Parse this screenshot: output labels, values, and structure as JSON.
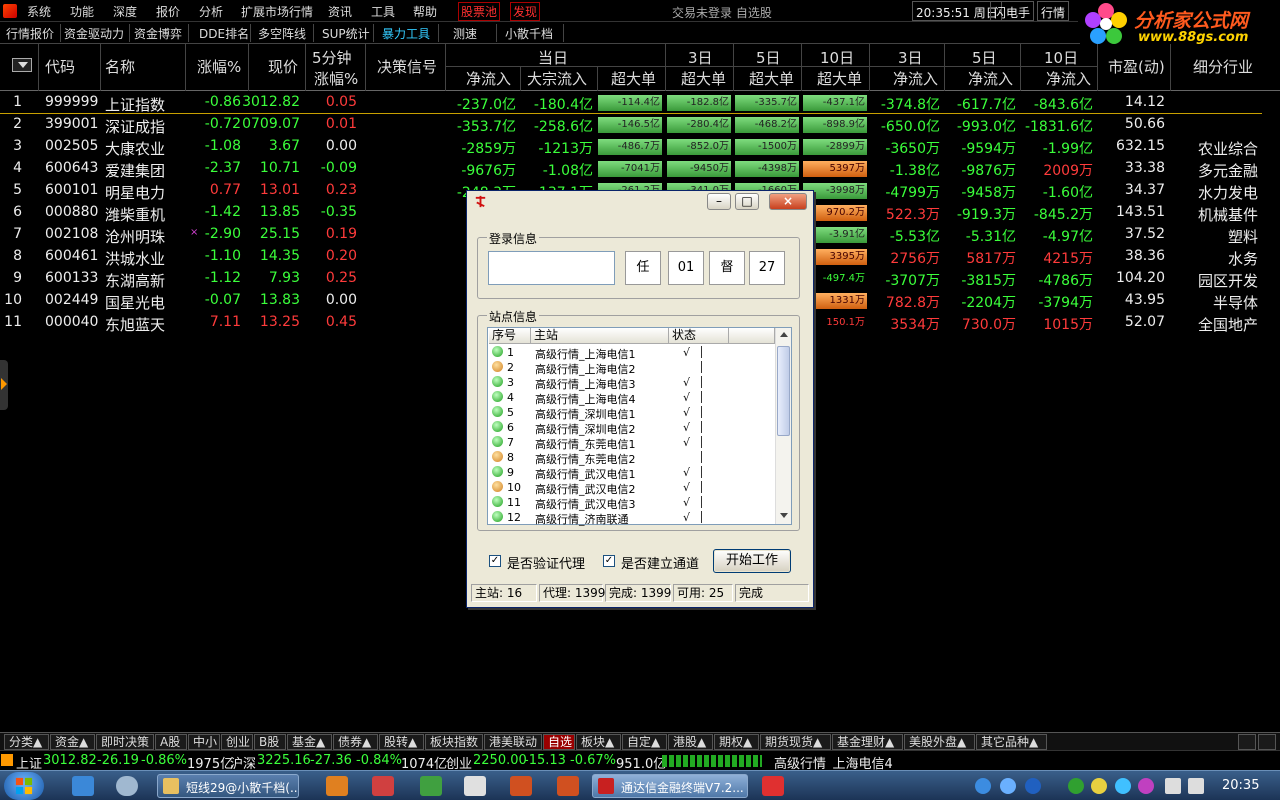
{
  "menu": {
    "items": [
      "系统",
      "功能",
      "深度",
      "报价",
      "分析",
      "扩展市场行情",
      "资讯",
      "工具",
      "帮助"
    ],
    "hot": [
      "股票池",
      "发现"
    ],
    "center_text": "交易未登录   自选股",
    "clock": "20:35:51 周日",
    "flash": "闪电手",
    "quote": "行情"
  },
  "brand": {
    "name": "分析家公式网",
    "url": "www.88gs.com"
  },
  "tabs": [
    "行情报价",
    "资金驱动力",
    "资金博弈",
    "DDE排名",
    "多空阵线",
    "SUP统计",
    "暴力工具",
    "测速",
    "小散千档"
  ],
  "active_tab": "暴力工具",
  "header": {
    "code": "代码",
    "name": "名称",
    "change": "涨幅%",
    "price": "现价",
    "speed_top": "5分钟",
    "speed_bottom": "涨幅%",
    "signal": "决策信号",
    "today": "当日",
    "d3": "3日",
    "d5": "5日",
    "d10": "10日",
    "net_in": "净流入",
    "block_in": "大宗流入",
    "super": "超大单",
    "pe": "市盈(动)",
    "industry": "细分行业"
  },
  "rows": [
    {
      "no": "1",
      "code": "999999",
      "name": "上证指数",
      "chg": "-0.86",
      "price": "3012.82",
      "spd": "0.05",
      "net": "-237.0亿",
      "blk": "-180.4亿",
      "s1": "-114.4亿",
      "s3": "-182.8亿",
      "s5": "-335.7亿",
      "s10": "-437.1亿",
      "n3": "-374.8亿",
      "n5": "-617.7亿",
      "n10": "-843.6亿",
      "pe": "14.12",
      "ind": "",
      "mark": ""
    },
    {
      "no": "2",
      "code": "399001",
      "name": "深证成指",
      "chg": "-0.72",
      "price": "0709.07",
      "spd": "0.01",
      "net": "-353.7亿",
      "blk": "-258.6亿",
      "s1": "-146.5亿",
      "s3": "-280.4亿",
      "s5": "-468.2亿",
      "s10": "-898.9亿",
      "n3": "-650.0亿",
      "n5": "-993.0亿",
      "n10": "-1831.6亿",
      "pe": "50.66",
      "ind": "",
      "mark": ""
    },
    {
      "no": "3",
      "code": "002505",
      "name": "大康农业",
      "chg": "-1.08",
      "price": "3.67",
      "spd": "0.00",
      "net": "-2859万",
      "blk": "-1213万",
      "s1": "-486.7万",
      "s3": "-852.0万",
      "s5": "-1500万",
      "s10": "-2899万",
      "n3": "-3650万",
      "n5": "-9594万",
      "n10": "-1.99亿",
      "pe": "632.15",
      "ind": "农业综合",
      "mark": ""
    },
    {
      "no": "4",
      "code": "600643",
      "name": "爱建集团",
      "chg": "-2.37",
      "price": "10.71",
      "spd": "-0.09",
      "net": "-9676万",
      "blk": "-1.08亿",
      "s1": "-7041万",
      "s3": "-9450万",
      "s5": "-4398万",
      "s10": "5397万",
      "n3": "-1.38亿",
      "n5": "-9876万",
      "n10": "2009万",
      "pe": "33.38",
      "ind": "多元金融",
      "mark": ""
    },
    {
      "no": "5",
      "code": "600101",
      "name": "明星电力",
      "chg": "0.77",
      "price": "13.01",
      "spd": "0.23",
      "net": "-248.3万",
      "blk": "-137.1万",
      "s1": "-261.2万",
      "s3": "-341.0万",
      "s5": "-1660万",
      "s10": "-3998万",
      "n3": "-4799万",
      "n5": "-9458万",
      "n10": "-1.60亿",
      "pe": "34.37",
      "ind": "水力发电",
      "mark": ""
    },
    {
      "no": "6",
      "code": "000880",
      "name": "潍柴重机",
      "chg": "-1.42",
      "price": "13.85",
      "spd": "-0.35",
      "net": "",
      "blk": "",
      "s1": "",
      "s3": "",
      "s5": "",
      "s10": "970.2万",
      "n3": "522.3万",
      "n5": "-919.3万",
      "n10": "-845.2万",
      "pe": "143.51",
      "ind": "机械基件",
      "mark": ""
    },
    {
      "no": "7",
      "code": "002108",
      "name": "沧州明珠",
      "chg": "-2.90",
      "price": "25.15",
      "spd": "0.19",
      "net": "",
      "blk": "",
      "s1": "",
      "s3": "",
      "s5": "",
      "s10": "-3.91亿",
      "n3": "-5.53亿",
      "n5": "-5.31亿",
      "n10": "-4.97亿",
      "pe": "37.52",
      "ind": "塑料",
      "mark": "×"
    },
    {
      "no": "8",
      "code": "600461",
      "name": "洪城水业",
      "chg": "-1.10",
      "price": "14.35",
      "spd": "0.20",
      "net": "",
      "blk": "",
      "s1": "",
      "s3": "",
      "s5": "",
      "s10": "3395万",
      "n3": "2756万",
      "n5": "5817万",
      "n10": "4215万",
      "pe": "38.36",
      "ind": "水务",
      "mark": ""
    },
    {
      "no": "9",
      "code": "600133",
      "name": "东湖高新",
      "chg": "-1.12",
      "price": "7.93",
      "spd": "0.25",
      "net": "",
      "blk": "",
      "s1": "",
      "s3": "",
      "s5": "",
      "s10": "-497.4万",
      "n3": "-3707万",
      "n5": "-3815万",
      "n10": "-4786万",
      "pe": "104.20",
      "ind": "园区开发",
      "mark": ""
    },
    {
      "no": "10",
      "code": "002449",
      "name": "国星光电",
      "chg": "-0.07",
      "price": "13.83",
      "spd": "0.00",
      "net": "",
      "blk": "",
      "s1": "",
      "s3": "",
      "s5": "",
      "s10": "1331万",
      "n3": "782.8万",
      "n5": "-2204万",
      "n10": "-3794万",
      "pe": "43.95",
      "ind": "半导体",
      "mark": ""
    },
    {
      "no": "11",
      "code": "000040",
      "name": "东旭蓝天",
      "chg": "7.11",
      "price": "13.25",
      "spd": "0.45",
      "net": "",
      "blk": "",
      "s1": "",
      "s3": "",
      "s5": "",
      "s10": "150.1万",
      "n3": "3534万",
      "n5": "730.0万",
      "n10": "1015万",
      "pe": "52.07",
      "ind": "全国地产",
      "mark": ""
    }
  ],
  "bottom_tabs": [
    "分类▲",
    "资金▲",
    "即时决策",
    "A股",
    "中小",
    "创业",
    "B股",
    "基金▲",
    "债券▲",
    "股转▲",
    "板块指数",
    "港美联动",
    "自选",
    "板块▲",
    "自定▲",
    "港股▲",
    "期权▲",
    "期货现货▲",
    "基金理财▲",
    "美股外盘▲",
    "其它品种▲"
  ],
  "active_bottom_tab": "自选",
  "strip": {
    "sh_label": "上证",
    "sh_val": "3012.82",
    "sh_chg": "-26.19",
    "sh_pct": "-0.86%",
    "sh_amt": "1975亿",
    "hs_label": "沪深",
    "hs_val": "3225.16",
    "hs_chg": "-27.36",
    "hs_pct": "-0.84%",
    "hs_amt": "1074亿",
    "cy_label": "创业",
    "cy_val": "2250.00",
    "cy_chg": "-15.13",
    "cy_pct": "-0.67%",
    "cy_amt": "951.0亿",
    "site": "高级行情_上海电信4"
  },
  "taskbar": {
    "tasks": [
      "短线29@小散千档(...",
      "通达信金融终端V7.2..."
    ],
    "time": "20:35"
  },
  "dialog": {
    "login_group": "登录信息",
    "tokens": [
      "任",
      "01",
      "督",
      "27"
    ],
    "site_group": "站点信息",
    "col_no": "序号",
    "col_site": "主站",
    "col_status": "状态",
    "sites": [
      {
        "no": "1",
        "name": "高级行情_上海电信1",
        "ok": true,
        "st": "√"
      },
      {
        "no": "2",
        "name": "高级行情_上海电信2",
        "ok": false,
        "st": ""
      },
      {
        "no": "3",
        "name": "高级行情_上海电信3",
        "ok": true,
        "st": "√"
      },
      {
        "no": "4",
        "name": "高级行情_上海电信4",
        "ok": true,
        "st": "√"
      },
      {
        "no": "5",
        "name": "高级行情_深圳电信1",
        "ok": true,
        "st": "√"
      },
      {
        "no": "6",
        "name": "高级行情_深圳电信2",
        "ok": true,
        "st": "√"
      },
      {
        "no": "7",
        "name": "高级行情_东莞电信1",
        "ok": true,
        "st": "√"
      },
      {
        "no": "8",
        "name": "高级行情_东莞电信2",
        "ok": false,
        "st": ""
      },
      {
        "no": "9",
        "name": "高级行情_武汉电信1",
        "ok": true,
        "st": "√"
      },
      {
        "no": "10",
        "name": "高级行情_武汉电信2",
        "ok": false,
        "st": "√"
      },
      {
        "no": "11",
        "name": "高级行情_武汉电信3",
        "ok": true,
        "st": "√"
      },
      {
        "no": "12",
        "name": "高级行情_济南联通",
        "ok": true,
        "st": "√"
      }
    ],
    "chk_proxy": "是否验证代理",
    "chk_channel": "是否建立通道",
    "start_btn": "开始工作",
    "status": [
      "主站: 16",
      "代理: 1399",
      "完成: 1399",
      "可用: 25",
      "完成"
    ]
  }
}
